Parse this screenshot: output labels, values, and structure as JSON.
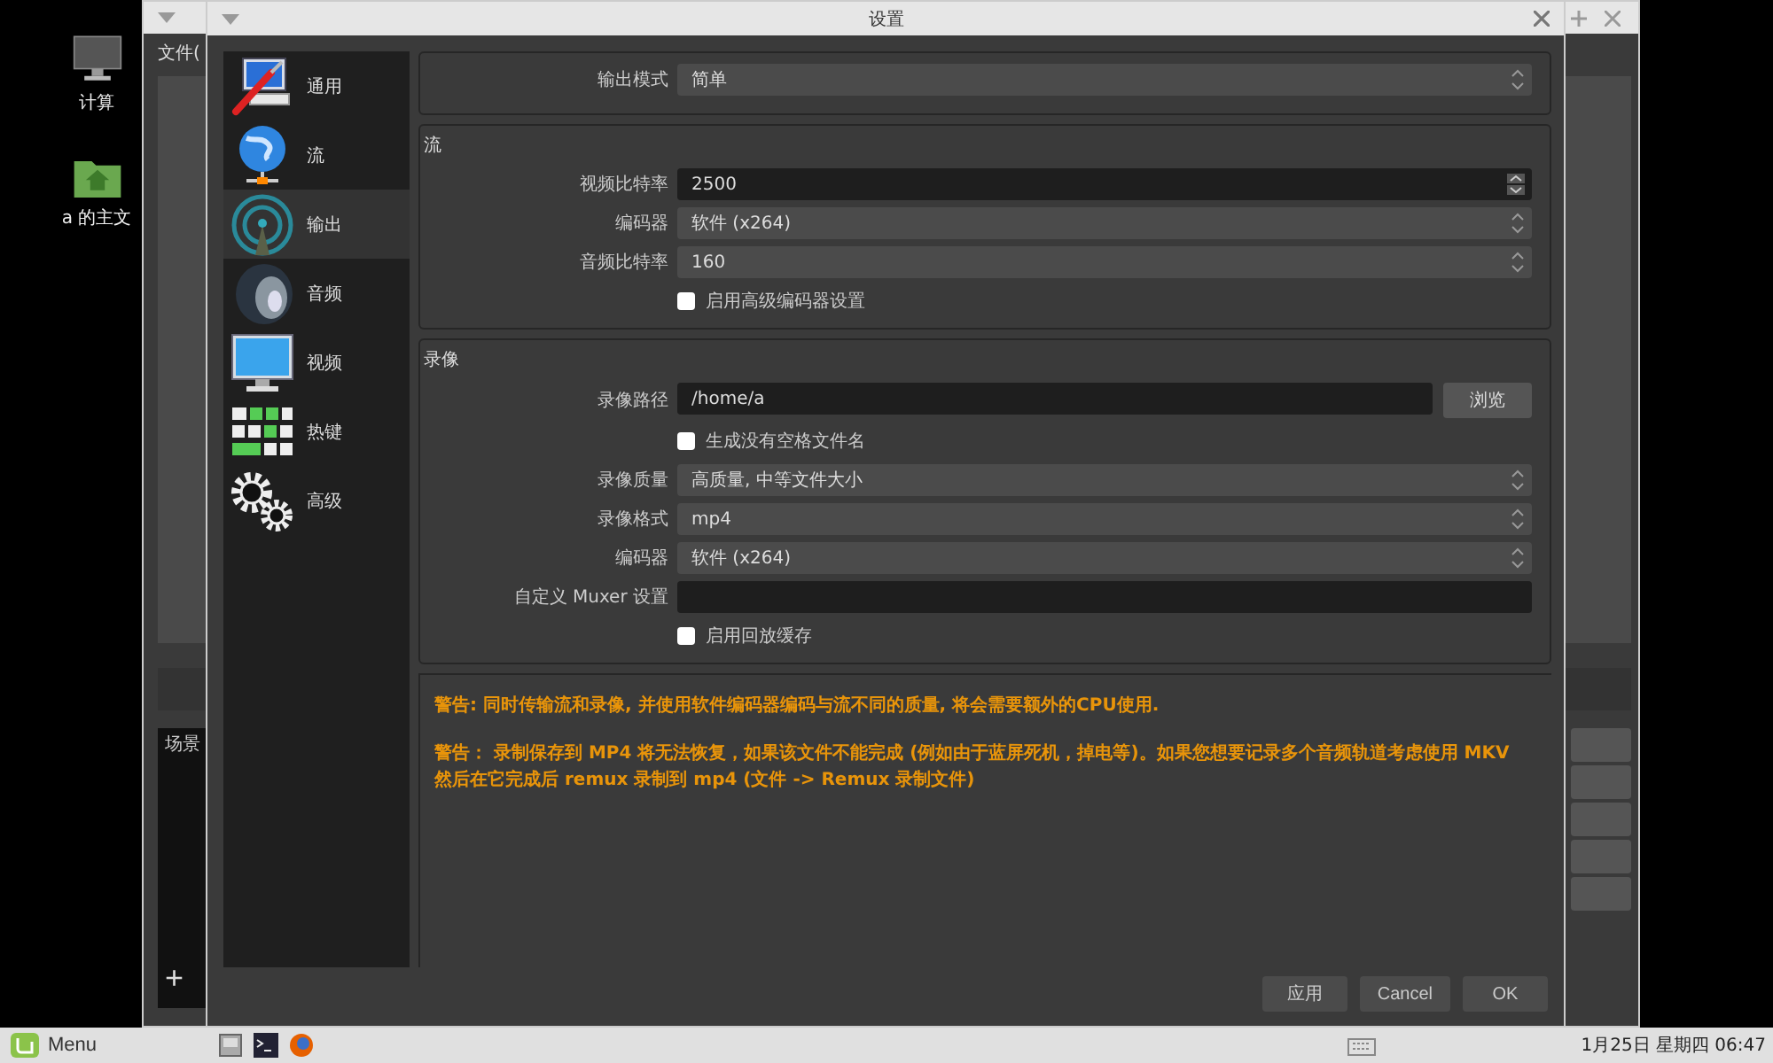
{
  "desktop": {
    "icons": [
      {
        "kind": "computer",
        "label": "计算"
      },
      {
        "kind": "home",
        "label": "a 的主文"
      }
    ]
  },
  "main_window": {
    "menu": "文件(",
    "scenes_title": "场景",
    "add_button": "+"
  },
  "dialog": {
    "title": "设置",
    "sidebar": [
      {
        "kind": "general",
        "label": "通用",
        "selected": false
      },
      {
        "kind": "stream",
        "label": "流",
        "selected": false
      },
      {
        "kind": "output",
        "label": "输出",
        "selected": true
      },
      {
        "kind": "audio",
        "label": "音频",
        "selected": false
      },
      {
        "kind": "video",
        "label": "视频",
        "selected": false
      },
      {
        "kind": "hotkeys",
        "label": "热键",
        "selected": false
      },
      {
        "kind": "advanced",
        "label": "高级",
        "selected": false
      }
    ],
    "output_mode": {
      "label": "输出模式",
      "value": "简单"
    },
    "sections": [
      {
        "title": "流",
        "rows": [
          {
            "kind": "spin",
            "label": "视频比特率",
            "value": "2500"
          },
          {
            "kind": "combo",
            "label": "编码器",
            "value": "软件 (x264)"
          },
          {
            "kind": "combo",
            "label": "音频比特率",
            "value": "160"
          },
          {
            "kind": "check",
            "label": "启用高级编码器设置",
            "checked": false
          }
        ]
      },
      {
        "title": "录像",
        "rows": [
          {
            "kind": "path",
            "label": "录像路径",
            "value": "/home/a",
            "button": "浏览"
          },
          {
            "kind": "check",
            "label": "生成没有空格文件名",
            "checked": false
          },
          {
            "kind": "combo",
            "label": "录像质量",
            "value": "高质量, 中等文件大小"
          },
          {
            "kind": "combo",
            "label": "录像格式",
            "value": "mp4"
          },
          {
            "kind": "combo",
            "label": "编码器",
            "value": "软件 (x264)"
          },
          {
            "kind": "text",
            "label": "自定义 Muxer 设置"
          },
          {
            "kind": "check",
            "label": "启用回放缓存",
            "checked": false
          }
        ]
      }
    ],
    "warnings": [
      "警告: 同时传输流和录像, 并使用软件编码器编码与流不同的质量, 将会需要额外的CPU使用.",
      "警告： 录制保存到 MP4 将无法恢复，如果该文件不能完成 (例如由于蓝屏死机，掉电等)。如果您想要记录多个音频轨道考虑使用 MKV 然后在它完成后 remux 录制到 mp4 (文件 -> Remux 录制文件)"
    ],
    "buttons": [
      "应用",
      "Cancel",
      "OK"
    ]
  },
  "taskbar": {
    "menu": "Menu",
    "clock": "1月25日 星期四 06:47"
  }
}
